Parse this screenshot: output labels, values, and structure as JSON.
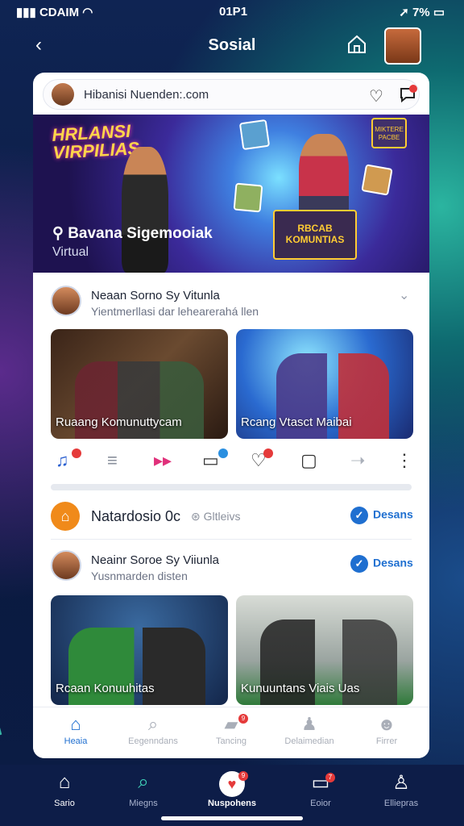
{
  "status": {
    "carrier": "CDAIM",
    "time": "01P1",
    "battery": "7%"
  },
  "topbar": {
    "title": "Sosial"
  },
  "urlbar": {
    "text": "Hibanisi Nuenden:.com"
  },
  "hero": {
    "logo_line1": "HRLANSI",
    "logo_line2": "VIRPILIAS",
    "location": "Bavana Sigemooiak",
    "subtitle": "Virtual",
    "box_text": "RBCAB KOMUNTIAS",
    "banner_text": "MIKTERE PACBE"
  },
  "post1": {
    "name": "Neaan Sorno Sy Vitunla",
    "sub": "Yientmerllasi dar lehearerahá llen",
    "thumb1": "Ruaang Komunuttycam",
    "thumb2": "Rcang Vtasct Maibai"
  },
  "group": {
    "name": "Natardosio 0c",
    "tag": "Gltleivs",
    "follow": "Desans"
  },
  "post2": {
    "name": "Neainr Soroe Sy Viiunla",
    "sub": "Yusnmarden disten",
    "follow": "Desans",
    "thumb1": "Rcaan Konuuhitas",
    "thumb2": "Kunuuntans Viais Uas"
  },
  "tabs": [
    {
      "label": "Heaia",
      "icon": "home-icon",
      "active": true
    },
    {
      "label": "Eegenndans",
      "icon": "search-icon"
    },
    {
      "label": "Tancing",
      "icon": "chat-icon",
      "badge": "9"
    },
    {
      "label": "Delaimedian",
      "icon": "user-icon"
    },
    {
      "label": "Firrer",
      "icon": "profile-icon"
    }
  ],
  "bottomnav": [
    {
      "label": "Sario",
      "icon": "home-icon"
    },
    {
      "label": "Miegns",
      "icon": "search-icon"
    },
    {
      "label": "Nuspohens",
      "icon": "heart-icon",
      "badge": "9"
    },
    {
      "label": "Eoior",
      "icon": "chat-icon",
      "badge": "7"
    },
    {
      "label": "Elliepras",
      "icon": "user-icon"
    }
  ],
  "colors": {
    "accent": "#1f6fd0",
    "teal": "#3fd1b8",
    "navy": "#0d1d48",
    "badge": "#e53a3a"
  }
}
